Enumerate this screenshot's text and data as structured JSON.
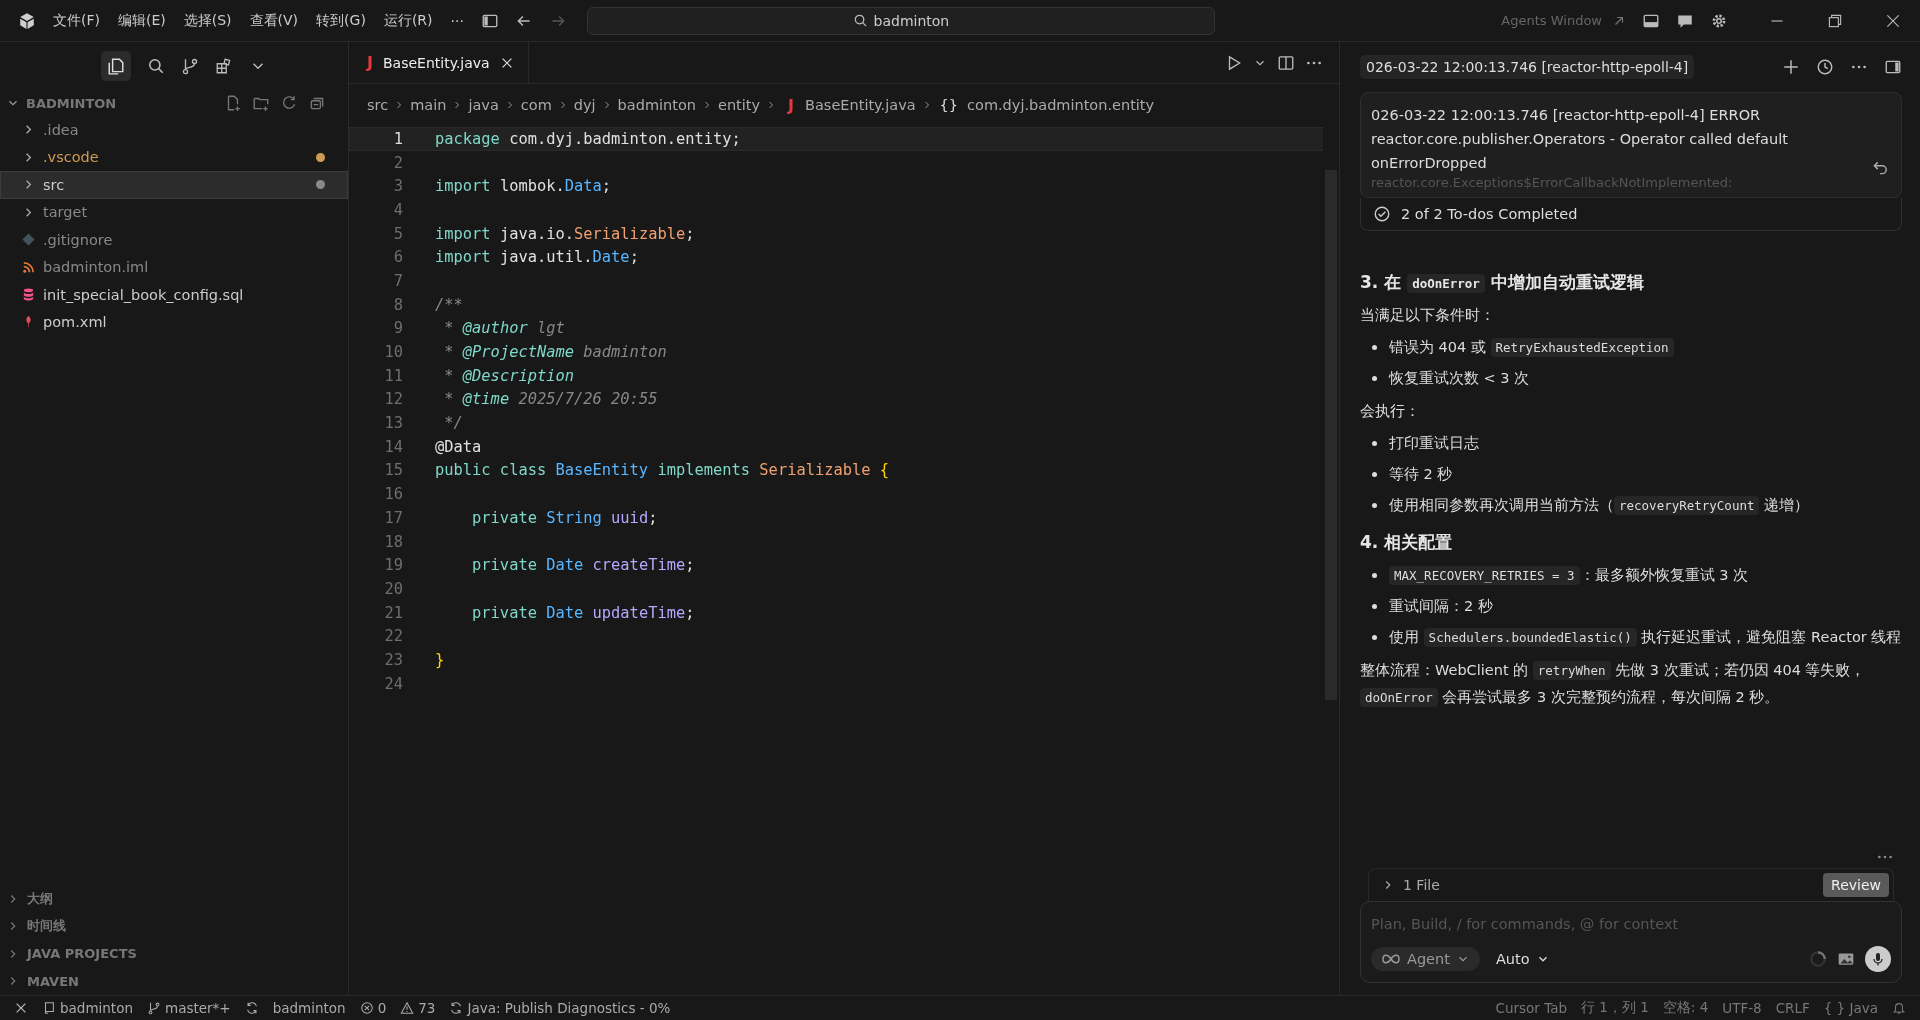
{
  "title_bar": {
    "menus": [
      "文件(F)",
      "编辑(E)",
      "选择(S)",
      "查看(V)",
      "转到(G)",
      "运行(R)"
    ],
    "more": "···",
    "search": "badminton",
    "agents_window": "Agents Window"
  },
  "sidebar": {
    "section": "BADMINTON",
    "expanded": true,
    "items": [
      {
        "name": ".idea",
        "kind": "folder",
        "dimmed": true,
        "selected": false
      },
      {
        "name": ".vscode",
        "kind": "folder",
        "dimmed": false,
        "selected": false,
        "color": "#d19a52"
      },
      {
        "name": "src",
        "kind": "folder",
        "dimmed": false,
        "selected": true,
        "color": "#8a8a8a"
      },
      {
        "name": "target",
        "kind": "folder",
        "dimmed": true,
        "selected": false
      },
      {
        "name": ".gitignore",
        "kind": "git",
        "dimmed": true,
        "selected": false
      },
      {
        "name": "badminton.iml",
        "kind": "feed",
        "dimmed": true,
        "selected": false
      },
      {
        "name": "init_special_book_config.sql",
        "kind": "database",
        "dimmed": false,
        "selected": false
      },
      {
        "name": "pom.xml",
        "kind": "pin",
        "dimmed": false,
        "selected": false
      }
    ],
    "panels": [
      {
        "label": "大纲",
        "expanded": false
      },
      {
        "label": "时间线",
        "expanded": false
      },
      {
        "label": "JAVA PROJECTS",
        "expanded": false
      },
      {
        "label": "MAVEN",
        "expanded": false
      }
    ]
  },
  "editor": {
    "tab": {
      "icon": "J",
      "label": "BaseEntity.java",
      "selected": true
    },
    "breadcrumb": [
      "src",
      "main",
      "java",
      "com",
      "dyj",
      "badminton",
      "entity"
    ],
    "breadcrumb_file": {
      "icon": "J",
      "label": "BaseEntity.java"
    },
    "breadcrumb_symbol": {
      "icon": "{}",
      "label": "com.dyj.badminton.entity"
    },
    "lines": [
      {
        "number": "1",
        "active": true,
        "tokens": [
          {
            "text": "package",
            "kind": "kw"
          },
          {
            "text": " com.dyj.badminton.entity;",
            "kind": "plain"
          }
        ]
      },
      {
        "number": "2",
        "active": false
      },
      {
        "number": "3",
        "active": false,
        "tokens": [
          {
            "text": "import",
            "kind": "kw"
          },
          {
            "text": " lombok.",
            "kind": "plain"
          },
          {
            "text": "Data",
            "kind": "type"
          },
          {
            "text": ";",
            "kind": "plain"
          }
        ]
      },
      {
        "number": "4",
        "active": false
      },
      {
        "number": "5",
        "active": false,
        "tokens": [
          {
            "text": "import",
            "kind": "kw"
          },
          {
            "text": " java.io.",
            "kind": "plain"
          },
          {
            "text": "Serializable",
            "kind": "iface"
          },
          {
            "text": ";",
            "kind": "plain"
          }
        ]
      },
      {
        "number": "6",
        "active": false,
        "tokens": [
          {
            "text": "import",
            "kind": "kw"
          },
          {
            "text": " java.util.",
            "kind": "plain"
          },
          {
            "text": "Date",
            "kind": "type"
          },
          {
            "text": ";",
            "kind": "plain"
          }
        ]
      },
      {
        "number": "7",
        "active": false
      },
      {
        "number": "8",
        "active": false,
        "tokens": [
          {
            "text": "/**",
            "kind": "comment"
          }
        ]
      },
      {
        "number": "9",
        "active": false,
        "tokens": [
          {
            "text": " * ",
            "kind": "comment"
          },
          {
            "text": "@author",
            "kind": "tag"
          },
          {
            "text": " lgt",
            "kind": "comment"
          }
        ]
      },
      {
        "number": "10",
        "active": false,
        "tokens": [
          {
            "text": " * ",
            "kind": "comment"
          },
          {
            "text": "@ProjectName",
            "kind": "tag"
          },
          {
            "text": " badminton",
            "kind": "comment"
          }
        ]
      },
      {
        "number": "11",
        "active": false,
        "tokens": [
          {
            "text": " * ",
            "kind": "comment"
          },
          {
            "text": "@Description",
            "kind": "tag"
          }
        ]
      },
      {
        "number": "12",
        "active": false,
        "tokens": [
          {
            "text": " * ",
            "kind": "comment"
          },
          {
            "text": "@time",
            "kind": "tag"
          },
          {
            "text": " 2025/7/26 20:55",
            "kind": "comment"
          }
        ]
      },
      {
        "number": "13",
        "active": false,
        "tokens": [
          {
            "text": " */",
            "kind": "comment"
          }
        ]
      },
      {
        "number": "14",
        "active": false,
        "tokens": [
          {
            "text": "@Data",
            "kind": "plain"
          }
        ]
      },
      {
        "number": "15",
        "active": false,
        "tokens": [
          {
            "text": "public class ",
            "kind": "kw"
          },
          {
            "text": "BaseEntity ",
            "kind": "type"
          },
          {
            "text": "implements ",
            "kind": "kw"
          },
          {
            "text": "Serializable ",
            "kind": "iface"
          },
          {
            "text": "{",
            "kind": "brace"
          }
        ]
      },
      {
        "number": "16",
        "active": false
      },
      {
        "number": "17",
        "active": false,
        "tokens": [
          {
            "text": "    private ",
            "kind": "kw"
          },
          {
            "text": "String ",
            "kind": "type"
          },
          {
            "text": "uuid",
            "kind": "field"
          },
          {
            "text": ";",
            "kind": "plain"
          }
        ]
      },
      {
        "number": "18",
        "active": false
      },
      {
        "number": "19",
        "active": false,
        "tokens": [
          {
            "text": "    private ",
            "kind": "kw"
          },
          {
            "text": "Date ",
            "kind": "type"
          },
          {
            "text": "createTime",
            "kind": "field"
          },
          {
            "text": ";",
            "kind": "plain"
          }
        ]
      },
      {
        "number": "20",
        "active": false
      },
      {
        "number": "21",
        "active": false,
        "tokens": [
          {
            "text": "    private ",
            "kind": "kw"
          },
          {
            "text": "Date ",
            "kind": "type"
          },
          {
            "text": "updateTime",
            "kind": "field"
          },
          {
            "text": ";",
            "kind": "plain"
          }
        ]
      },
      {
        "number": "22",
        "active": false
      },
      {
        "number": "23",
        "active": false,
        "tokens": [
          {
            "text": "}",
            "kind": "brace"
          }
        ]
      },
      {
        "number": "24",
        "active": false
      }
    ]
  },
  "agent_panel": {
    "tab": "026-03-22 12:00:13.746 [reactor-http-epoll-4]",
    "message": "026-03-22 12:00:13.746 [reactor-http-epoll-4] ERROR reactor.core.publisher.Operators - Operator called default onErrorDropped",
    "message_cut": "reactor.core.Exceptions$ErrorCallbackNotImplemented:",
    "todos": "2 of 2 To-dos Completed",
    "blocks": [
      {
        "kind": "heading",
        "segments": [
          {
            "text": "3. 在 ",
            "kind": "text"
          },
          {
            "text": "doOnError",
            "kind": "code"
          },
          {
            "text": " 中增加自动重试逻辑",
            "kind": "text"
          }
        ]
      },
      {
        "kind": "para",
        "segments": [
          {
            "text": "当满足以下条件时：",
            "kind": "text"
          }
        ]
      },
      {
        "kind": "list",
        "items": [
          [
            {
              "text": "错误为 404 或 ",
              "kind": "text"
            },
            {
              "text": "RetryExhaustedException",
              "kind": "code"
            }
          ],
          [
            {
              "text": "恢复重试次数 < 3 次",
              "kind": "text"
            }
          ]
        ]
      },
      {
        "kind": "para",
        "segments": [
          {
            "text": "会执行：",
            "kind": "text"
          }
        ]
      },
      {
        "kind": "list",
        "items": [
          [
            {
              "text": "打印重试日志",
              "kind": "text"
            }
          ],
          [
            {
              "text": "等待 2 秒",
              "kind": "text"
            }
          ],
          [
            {
              "text": "使用相同参数再次调用当前方法（",
              "kind": "text"
            },
            {
              "text": "recoveryRetryCount",
              "kind": "code"
            },
            {
              "text": " 递增）",
              "kind": "text"
            }
          ]
        ]
      },
      {
        "kind": "heading",
        "segments": [
          {
            "text": "4. 相关配置",
            "kind": "text"
          }
        ]
      },
      {
        "kind": "list",
        "items": [
          [
            {
              "text": "MAX_RECOVERY_RETRIES = 3",
              "kind": "code"
            },
            {
              "text": "：最多额外恢复重试 3 次",
              "kind": "text"
            }
          ],
          [
            {
              "text": "重试间隔：2 秒",
              "kind": "text"
            }
          ],
          [
            {
              "text": "使用 ",
              "kind": "text"
            },
            {
              "text": "Schedulers.boundedElastic()",
              "kind": "code"
            },
            {
              "text": " 执行延迟重试，避免阻塞 Reactor 线程",
              "kind": "text"
            }
          ]
        ]
      },
      {
        "kind": "para",
        "segments": [
          {
            "text": "整体流程：WebClient 的 ",
            "kind": "text"
          },
          {
            "text": "retryWhen",
            "kind": "code"
          },
          {
            "text": " 先做 3 次重试；若仍因 404 等失败，",
            "kind": "text"
          },
          {
            "text": "doOnError",
            "kind": "code"
          },
          {
            "text": " 会再尝试最多 3 次完整预约流程，每次间隔 2 秒。",
            "kind": "text"
          }
        ]
      }
    ],
    "files": "1 File",
    "review": "Review",
    "input": {
      "placeholder": "Plan, Build, / for commands, @ for context"
    },
    "mode": "Agent",
    "model": "Auto"
  },
  "status_bar": {
    "left": [
      {
        "kind": "repo",
        "text": "badminton"
      },
      {
        "kind": "branch",
        "text": "master*+"
      },
      {
        "kind": "sync"
      },
      {
        "kind": "plain",
        "text": "badminton"
      },
      {
        "kind": "errors",
        "text": "0"
      },
      {
        "kind": "warnings",
        "text": "73"
      },
      {
        "kind": "sync",
        "text": "Java: Publish Diagnostics - 0%"
      }
    ],
    "right": [
      "Cursor Tab",
      "行 1，列 1",
      "空格: 4",
      "UTF-8",
      "CRLF",
      "{ } Java"
    ]
  }
}
